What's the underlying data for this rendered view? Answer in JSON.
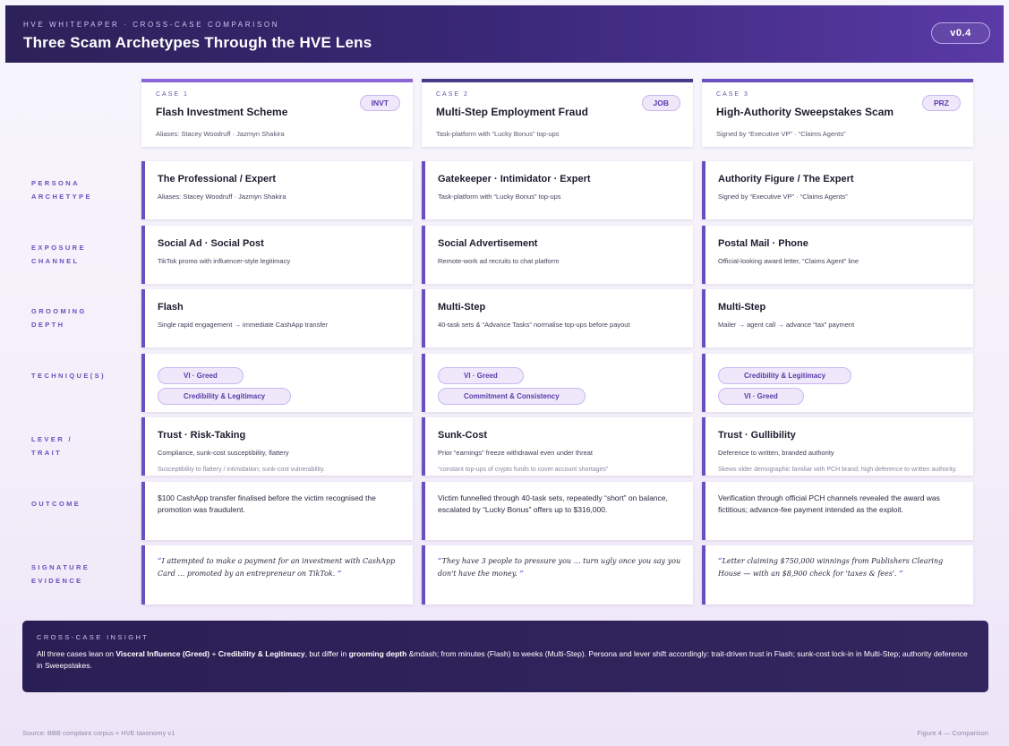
{
  "header": {
    "kicker": "HVE WHITEPAPER · CROSS-CASE COMPARISON",
    "title": "Three Scam Archetypes Through the HVE Lens",
    "version": "v0.4"
  },
  "cases": [
    {
      "num": "CASE 1",
      "title": "Flash Investment Scheme",
      "tag": "INVT",
      "sub": "Aliases: Stacey Woodruff · Jazmyn Shakira"
    },
    {
      "num": "CASE 2",
      "title": "Multi-Step Employment Fraud",
      "tag": "JOB",
      "sub": "Task-platform with “Lucky Bonus” top-ups"
    },
    {
      "num": "CASE 3",
      "title": "High-Authority Sweepstakes Scam",
      "tag": "PRZ",
      "sub": "Signed by “Executive VP” · “Claims Agents”"
    }
  ],
  "row_labels": {
    "persona": [
      "PERSONA",
      "ARCHETYPE"
    ],
    "exposure": [
      "EXPOSURE",
      "CHANNEL"
    ],
    "grooming": [
      "GROOMING",
      "DEPTH"
    ],
    "technique": [
      "TECHNIQUE(S)"
    ],
    "lever": [
      "LEVER /",
      "TRAIT"
    ],
    "outcome": [
      "OUTCOME"
    ],
    "evidence": [
      "SIGNATURE",
      "EVIDENCE"
    ]
  },
  "persona": [
    {
      "title": "The Professional / Expert",
      "desc": "Aliases: Stacey Woodruff · Jazmyn Shakira"
    },
    {
      "title": "Gatekeeper · Intimidator · Expert",
      "desc": "Task-platform with “Lucky Bonus” top-ups"
    },
    {
      "title": "Authority Figure / The Expert",
      "desc": "Signed by “Executive VP” · “Claims Agents”"
    }
  ],
  "exposure": [
    {
      "title": "Social Ad · Social Post",
      "desc": "TikTok promo with influencer-style legitimacy"
    },
    {
      "title": "Social Advertisement",
      "desc": "Remote-work ad recruits to chat platform"
    },
    {
      "title": "Postal Mail · Phone",
      "desc": "Official-looking award letter, “Claims Agent” line"
    }
  ],
  "grooming": [
    {
      "title": "Flash",
      "desc": "Single rapid engagement → immediate CashApp transfer"
    },
    {
      "title": "Multi-Step",
      "desc": "40-task sets & “Advance Tasks” normalise top-ups before payout"
    },
    {
      "title": "Multi-Step",
      "desc": "Mailer → agent call → advance “tax” payment"
    }
  ],
  "techniques": [
    [
      "VI · Greed",
      "Credibility & Legitimacy"
    ],
    [
      "VI · Greed",
      "Commitment & Consistency"
    ],
    [
      "Credibility & Legitimacy",
      "VI · Greed"
    ]
  ],
  "lever": [
    {
      "title": "Trust · Risk-Taking",
      "desc": "Compliance, sunk-cost susceptibility, flattery",
      "note": "Susceptibility to flattery / intimidation; sunk-cost vulnerability."
    },
    {
      "title": "Sunk-Cost",
      "desc": "Prior “earnings” freeze withdrawal even under threat",
      "note": "“constant top-ups of crypto funds to cover account shortages”"
    },
    {
      "title": "Trust · Gullibility",
      "desc": "Deference to written, branded authority",
      "note": "Skews older demographic familiar with PCH brand; high deference to written authority."
    }
  ],
  "outcome": [
    "$100 CashApp transfer finalised before the victim recognised the promotion was fraudulent.",
    "Victim funnelled through 40-task sets, repeatedly “short” on balance, escalated by “Lucky Bonus” offers up to $316,000.",
    "Verification through official PCH channels revealed the award was fictitious; advance-fee payment intended as the exploit."
  ],
  "evidence": [
    "I attempted to make a payment for an investment with CashApp Card … promoted by an entrepreneur on TikTok.",
    "They have 3 people to pressure you … turn ugly once you say you don't have the money.",
    "Letter claiming $750,000 winnings from Publishers Clearing House — with an $8,900 check for 'taxes & fees'."
  ],
  "quote_open": "“",
  "quote_close": "”",
  "insight": {
    "kicker": "CROSS-CASE INSIGHT",
    "t1": "All three cases lean on ",
    "b1": "Visceral Influence (Greed)",
    "t2": " + ",
    "b2": "Credibility & Legitimacy",
    "t3": ", but differ in ",
    "b3": "grooming depth",
    "t4": " &mdash; from minutes (Flash) to weeks (Multi-Step). Persona and lever shift accordingly: trait-driven trust in Flash; sunk-cost lock-in in Multi-Step; authority deference in Sweepstakes."
  },
  "footer": {
    "source": "Source: BBB complaint corpus + HVE taxonomy v1",
    "figure": "Figure 4 — Comparison"
  },
  "colors": {
    "accent": "#6a4fbf",
    "header_dark": "#2c2158",
    "pill_bg": "#efe8fb",
    "insight_bg": "#2a1f55"
  }
}
